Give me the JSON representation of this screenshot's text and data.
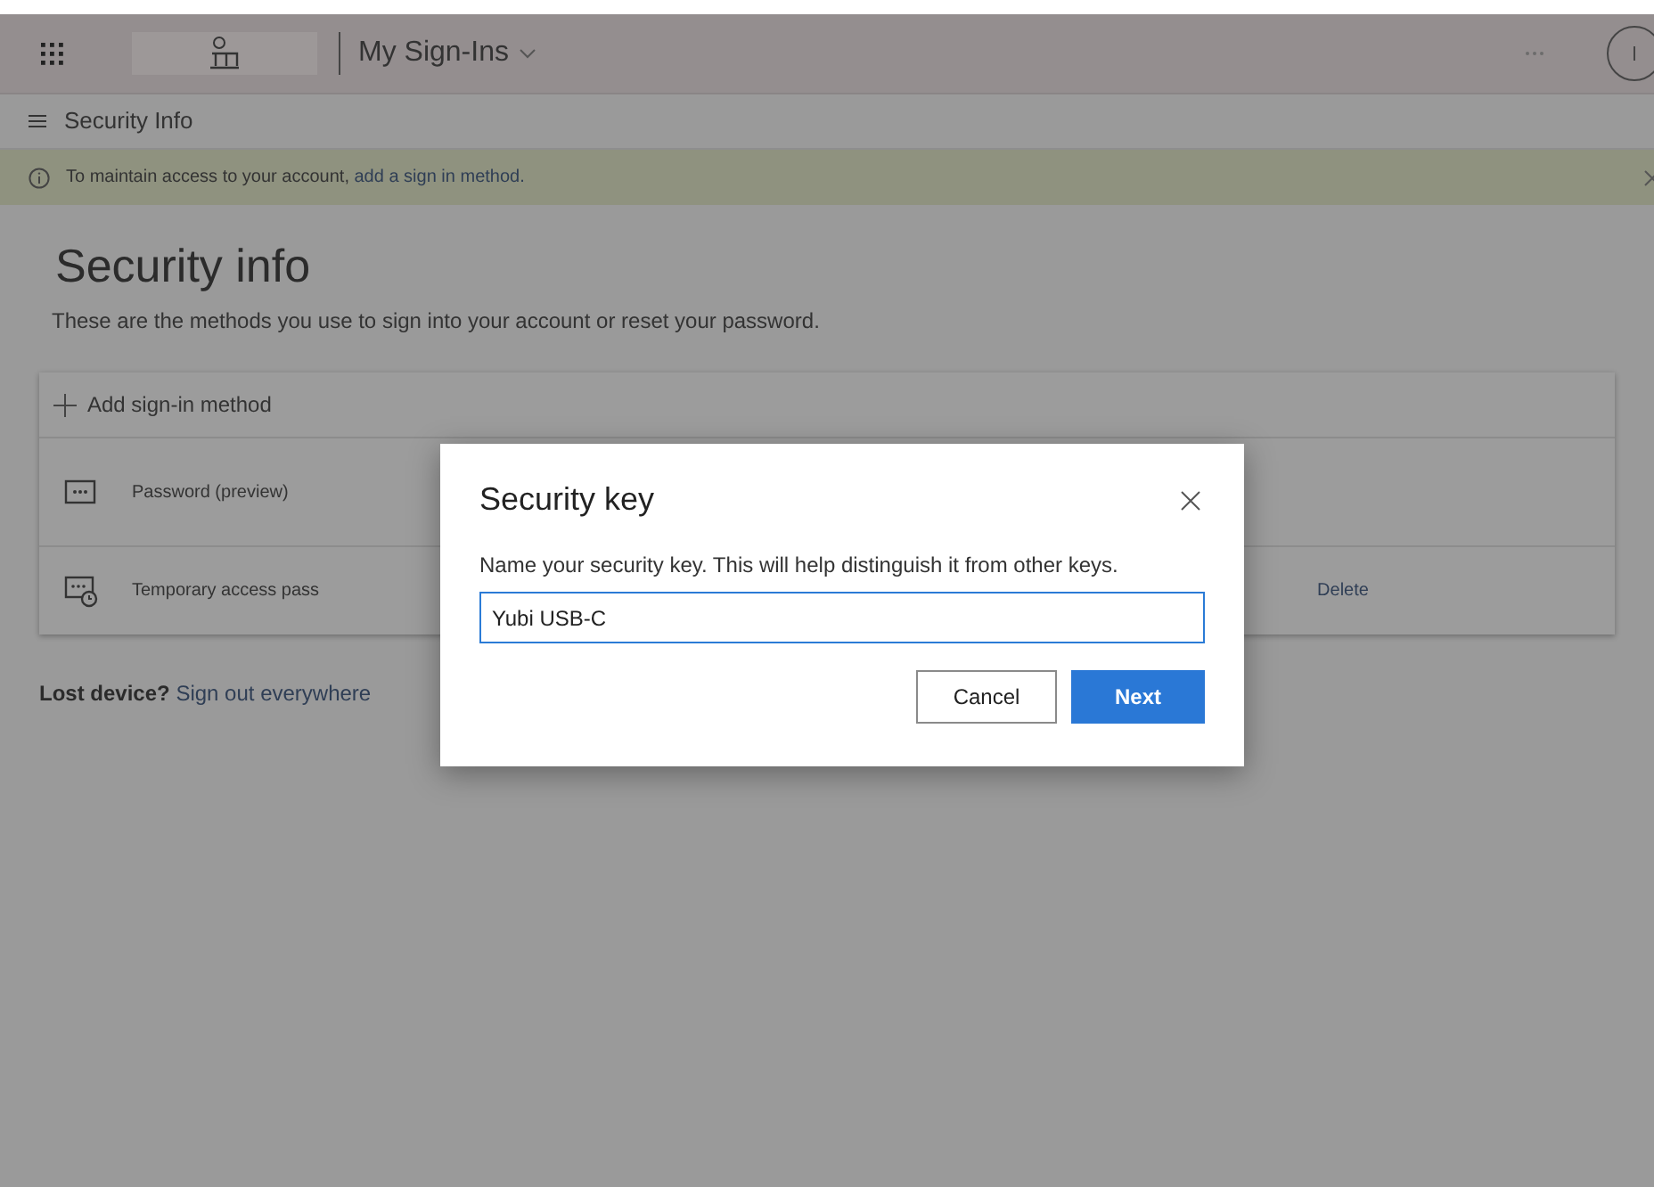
{
  "top_bar": {
    "app_title": "My Sign-Ins"
  },
  "nav": {
    "title": "Security Info"
  },
  "banner": {
    "text": "To maintain access to your account, ",
    "link": "add a sign in method."
  },
  "page": {
    "heading": "Security info",
    "subtitle": "These are the methods you use to sign into your account or reset your password."
  },
  "methods": {
    "add_label": "Add sign-in method",
    "items": [
      {
        "kind": "password",
        "name": "Password (preview)"
      },
      {
        "kind": "temporary",
        "name": "Temporary access pass",
        "action": "Delete"
      }
    ]
  },
  "lost_device": {
    "label": "Lost device?",
    "link": "Sign out everywhere"
  },
  "dialog": {
    "title": "Security key",
    "description": "Name your security key. This will help distinguish it from other keys.",
    "value": "Yubi USB-C",
    "buttons": [
      {
        "kind": "secondary",
        "label": "Cancel"
      },
      {
        "kind": "primary",
        "label": "Next"
      }
    ]
  }
}
